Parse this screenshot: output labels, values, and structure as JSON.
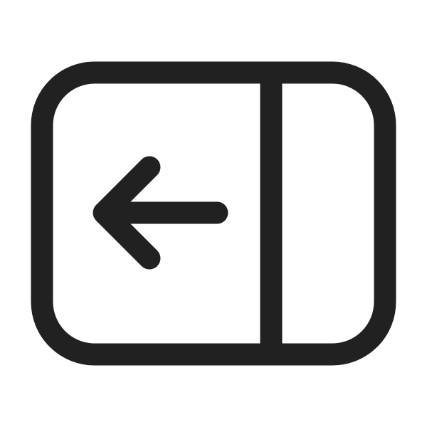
{
  "icon": {
    "name": "panel-right-collapse-arrow-left-icon",
    "stroke_color": "#212121",
    "background_color": "#ffffff"
  }
}
